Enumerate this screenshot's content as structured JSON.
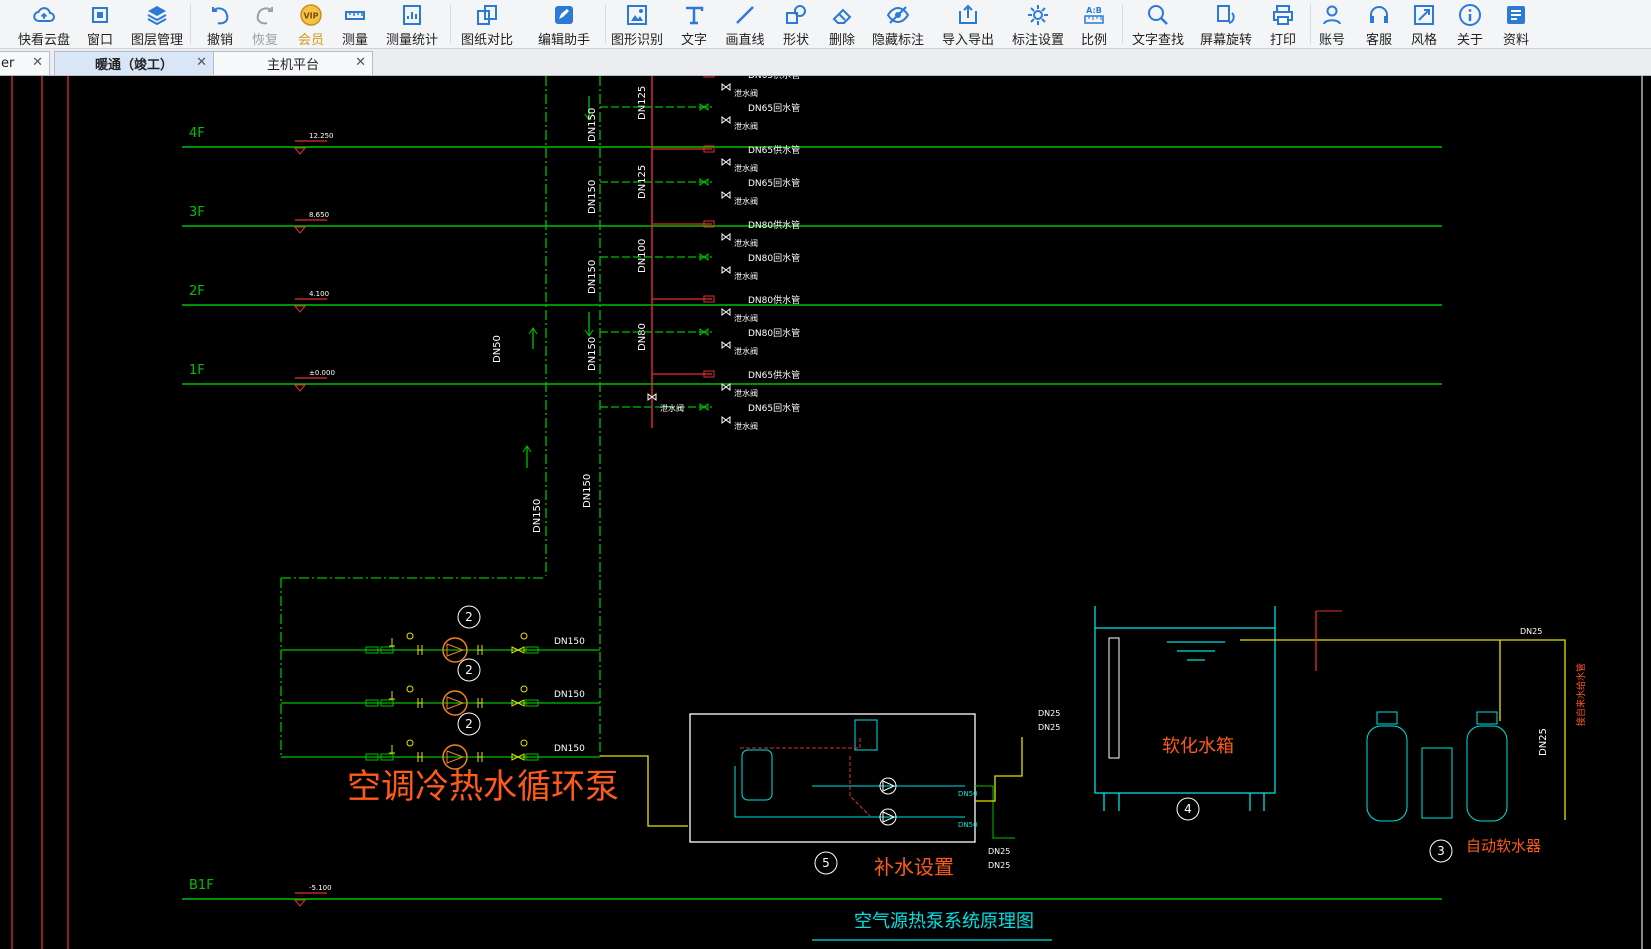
{
  "toolbar": {
    "items": [
      {
        "label": "快看云盘",
        "icon": "cloud-icon"
      },
      {
        "label": "窗口",
        "icon": "window-icon"
      },
      {
        "label": "图层管理",
        "icon": "layers-icon"
      },
      {
        "label": "撤销",
        "icon": "undo-icon"
      },
      {
        "label": "恢复",
        "icon": "redo-icon"
      },
      {
        "label": "会员",
        "icon": "vip-icon"
      },
      {
        "label": "测量",
        "icon": "measure-icon"
      },
      {
        "label": "测量统计",
        "icon": "measure-stats-icon"
      },
      {
        "label": "图纸对比",
        "icon": "compare-icon"
      },
      {
        "label": "编辑助手",
        "icon": "edit-assistant-icon"
      },
      {
        "label": "图形识别",
        "icon": "shape-recognize-icon"
      },
      {
        "label": "文字",
        "icon": "text-icon"
      },
      {
        "label": "画直线",
        "icon": "line-icon"
      },
      {
        "label": "形状",
        "icon": "shape-icon"
      },
      {
        "label": "删除",
        "icon": "eraser-icon"
      },
      {
        "label": "隐藏标注",
        "icon": "hide-annotation-icon"
      },
      {
        "label": "导入导出",
        "icon": "import-export-icon"
      },
      {
        "label": "标注设置",
        "icon": "annotation-settings-icon"
      },
      {
        "label": "比例",
        "icon": "scale-icon"
      },
      {
        "label": "文字查找",
        "icon": "text-search-icon"
      },
      {
        "label": "屏幕旋转",
        "icon": "rotate-screen-icon"
      },
      {
        "label": "打印",
        "icon": "printer-icon"
      },
      {
        "label": "账号",
        "icon": "account-icon"
      },
      {
        "label": "客服",
        "icon": "headset-icon"
      },
      {
        "label": "风格",
        "icon": "style-icon"
      },
      {
        "label": "关于",
        "icon": "info-icon"
      },
      {
        "label": "资料",
        "icon": "resources-icon"
      }
    ],
    "accent": "#2a7ad6",
    "vip_color": "#d49a1e"
  },
  "tabs": [
    {
      "label": "er",
      "active": false
    },
    {
      "label": "暖通（竣工）",
      "active": true
    },
    {
      "label": "主机平台",
      "active": false
    }
  ],
  "drawing": {
    "floors": [
      {
        "name": "4F",
        "elev": "12.250"
      },
      {
        "name": "3F",
        "elev": "8.650"
      },
      {
        "name": "2F",
        "elev": "4.100"
      },
      {
        "name": "1F",
        "elev": "±0.000"
      },
      {
        "name": "B1F",
        "elev": "-5.100"
      }
    ],
    "riser_labels": [
      "DN125",
      "DN125",
      "DN100",
      "DN80",
      "DN150",
      "DN150",
      "DN150",
      "DN150",
      "DN150",
      "DN150",
      "DN50"
    ],
    "branch_supply": [
      "DN65供水管",
      "DN65供水管",
      "DN80供水管",
      "DN80供水管",
      "DN65供水管"
    ],
    "branch_return": [
      "DN65回水管",
      "DN65回水管",
      "DN80回水管",
      "DN80回水管",
      "DN65回水管"
    ],
    "valve_label": "泄水阀",
    "pump_label": "DN150",
    "pump_number": "2",
    "pump_group_title": "空调冷热水循环泵",
    "makeup_title": "补水设置",
    "makeup_number": "5",
    "makeup_dn": [
      "DN50",
      "DN50"
    ],
    "makeup_pipes": [
      "DN25",
      "DN25"
    ],
    "tank_title": "软化水箱",
    "tank_number": "4",
    "tank_pipes": [
      "DN25",
      "DN25"
    ],
    "softener_title": "自动软水器",
    "softener_number": "3",
    "softener_pipes": [
      "DN25",
      "DN25"
    ],
    "softener_side_label": "接自来水给水管",
    "diagram_title": "空气源热泵系统原理图",
    "colors": {
      "floor_line": "#00c000",
      "pipe_green": "#00c000",
      "pipe_red": "#e03030",
      "pipe_cyan": "#00e0e0",
      "pipe_yellow": "#e8e000",
      "label_orange": "#ff5a1a",
      "text_white": "#ffffff"
    }
  }
}
